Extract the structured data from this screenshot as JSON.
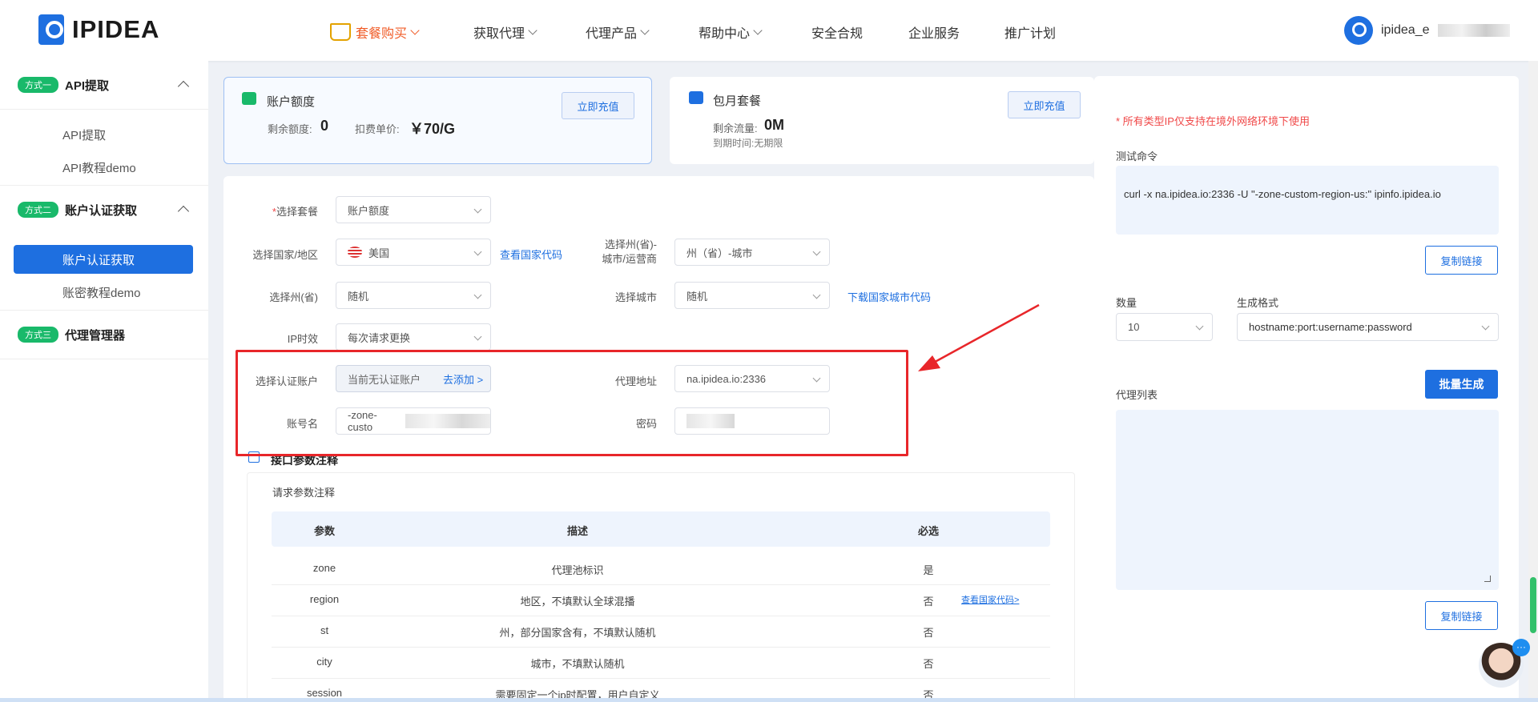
{
  "brand": {
    "name": "IPIDEA"
  },
  "nav": [
    "套餐购买",
    "获取代理",
    "代理产品",
    "帮助中心",
    "安全合规",
    "企业服务",
    "推广计划"
  ],
  "user": {
    "name": "ipidea_e"
  },
  "sidebar": {
    "g1": {
      "tag": "方式一",
      "title": "API提取",
      "items": [
        "API提取",
        "API教程demo"
      ]
    },
    "g2": {
      "tag": "方式二",
      "title": "账户认证获取",
      "items": [
        "账户认证获取",
        "账密教程demo"
      ]
    },
    "g3": {
      "tag": "方式三",
      "title": "代理管理器"
    }
  },
  "balance_card": {
    "title": "账户额度",
    "remain_label": "剩余额度:",
    "remain_value": "0",
    "price_label": "扣费单价:",
    "price_value": "￥70/G",
    "button": "立即充值"
  },
  "monthly_card": {
    "title": "包月套餐",
    "traffic_label": "剩余流量:",
    "traffic_value": "0M",
    "expiry": "到期时间:无期限",
    "button": "立即充值"
  },
  "form": {
    "package_label": "选择套餐",
    "package_value": "账户额度",
    "country_label": "选择国家/地区",
    "country_value": "美国",
    "country_link": "查看国家代码",
    "region_label": "选择州(省)-\n城市/运营商",
    "region_value": "州（省）-城市",
    "state_label": "选择州(省)",
    "state_value": "随机",
    "city_label": "选择城市",
    "city_value": "随机",
    "city_link": "下载国家城市代码",
    "ip_label": "IP时效",
    "ip_value": "每次请求更换",
    "account_label": "选择认证账户",
    "account_value": "当前无认证账户",
    "account_add": "去添加 >",
    "proxy_label": "代理地址",
    "proxy_value": "na.ipidea.io:2336",
    "username_label": "账号名",
    "username_value": "-zone-custo",
    "password_label": "密码"
  },
  "params": {
    "section_title": "接口参数注释",
    "sub_title": "请求参数注释",
    "headers": [
      "参数",
      "描述",
      "必选"
    ],
    "rows": [
      {
        "p": "zone",
        "d": "代理池标识",
        "r": "是",
        "link": ""
      },
      {
        "p": "region",
        "d": "地区，不填默认全球混播",
        "r": "否",
        "link": "查看国家代码>"
      },
      {
        "p": "st",
        "d": "州，部分国家含有，不填默认随机",
        "r": "否",
        "link": ""
      },
      {
        "p": "city",
        "d": "城市，不填默认随机",
        "r": "否",
        "link": ""
      },
      {
        "p": "session",
        "d": "需要固定一个ip时配置，用户自定义",
        "r": "否",
        "link": ""
      }
    ]
  },
  "right": {
    "notice": "* 所有类型IP仅支持在境外网络环境下使用",
    "test_label": "测试命令",
    "test_cmd": "curl -x na.ipidea.io:2336 -U \"-zone-custom-region-us:\" ipinfo.ipidea.io",
    "copy1": "复制链接",
    "qty_label": "数量",
    "qty_value": "10",
    "format_label": "生成格式",
    "format_value": "hostname:port:username:password",
    "generate": "批量生成",
    "list_label": "代理列表",
    "copy2": "复制链接"
  },
  "colors": {
    "accent": "#1e6fe0",
    "active_nav": "#f05c28",
    "tag_green": "#19b96a",
    "highlight_red": "#e8262a",
    "notice_red": "#f04848"
  }
}
